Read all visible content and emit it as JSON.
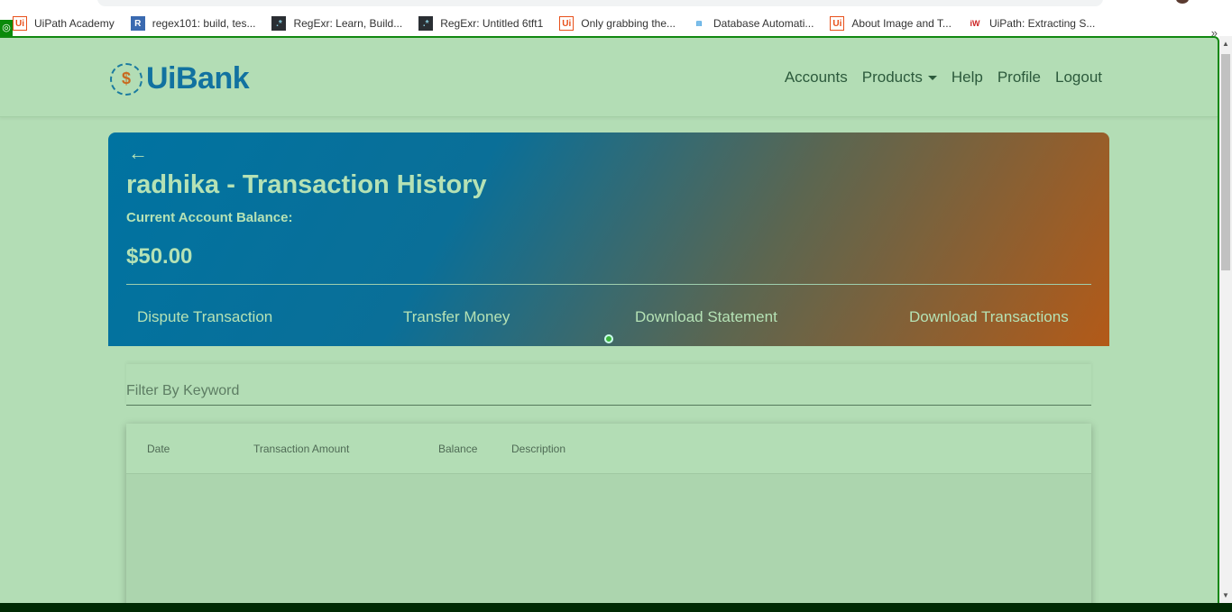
{
  "bookmarks": [
    {
      "label": "UiPath Academy",
      "icon": "uipath-icon"
    },
    {
      "label": "regex101: build, tes...",
      "icon": "regex101-icon"
    },
    {
      "label": "RegExr: Learn, Build...",
      "icon": "regexr-icon"
    },
    {
      "label": "RegExr: Untitled 6tft1",
      "icon": "regexr-icon"
    },
    {
      "label": "Only grabbing the...",
      "icon": "uipath-icon"
    },
    {
      "label": "Database Automati...",
      "icon": "chercher-tech-icon"
    },
    {
      "label": "About Image and T...",
      "icon": "uipath-icon"
    },
    {
      "label": "UiPath: Extracting S...",
      "icon": "iw-icon"
    }
  ],
  "more": "»",
  "brand": "UiBank",
  "nav": {
    "accounts": "Accounts",
    "products": "Products",
    "help": "Help",
    "profile": "Profile",
    "logout": "Logout"
  },
  "hero": {
    "back": "←",
    "title": "radhika - Transaction History",
    "balance_label": "Current Account Balance:",
    "balance": "$50.00",
    "actions": {
      "dispute": "Dispute Transaction",
      "transfer": "Transfer Money",
      "statement": "Download Statement",
      "transactions": "Download Transactions"
    }
  },
  "filter": {
    "placeholder": "Filter By Keyword"
  },
  "table": {
    "columns": [
      "Date",
      "Transaction Amount",
      "Balance",
      "Description"
    ],
    "rows": []
  }
}
